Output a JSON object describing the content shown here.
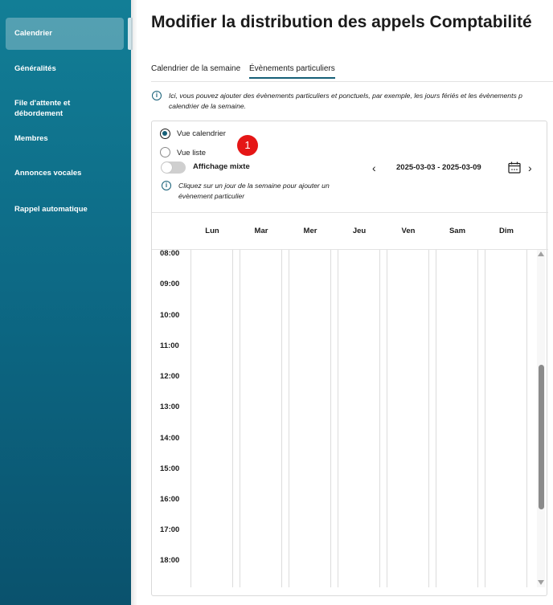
{
  "sidebar": {
    "items": [
      {
        "label": "Calendrier",
        "active": true
      },
      {
        "label": "Généralités"
      },
      {
        "label": "File d'attente et débordement"
      },
      {
        "label": "Membres"
      },
      {
        "label": "Annonces vocales"
      },
      {
        "label": "Rappel automatique"
      }
    ]
  },
  "header": {
    "title": "Modifier la distribution des appels Comptabilité"
  },
  "tabs": [
    {
      "label": "Calendrier de la semaine",
      "active": false
    },
    {
      "label": "Évènements particuliers",
      "active": true
    }
  ],
  "info": {
    "line1": "Ici, vous pouvez ajouter des évènements particuliers et ponctuels, par exemple, les jours fériés et les évènements p",
    "line2": "calendrier de la semaine."
  },
  "view": {
    "calendar_label": "Vue calendrier",
    "calendar_selected": true,
    "list_label": "Vue liste",
    "mixed_label": "Affichage mixte",
    "mixed_on": false,
    "badge": "1",
    "help_line1": "Cliquez sur un jour de la semaine pour ajouter un",
    "help_line2": "évènement particulier"
  },
  "navigation": {
    "date_range": "2025-03-03 - 2025-03-09"
  },
  "calendar": {
    "days": [
      "Lun",
      "Mar",
      "Mer",
      "Jeu",
      "Ven",
      "Sam",
      "Dim"
    ],
    "hours": [
      "08:00",
      "09:00",
      "10:00",
      "11:00",
      "12:00",
      "13:00",
      "14:00",
      "15:00",
      "16:00",
      "17:00",
      "18:00"
    ]
  },
  "colors": {
    "sidebar_top": "#127e96",
    "sidebar_bottom": "#0a526d",
    "accent": "#155f77",
    "badge": "#e51616"
  }
}
